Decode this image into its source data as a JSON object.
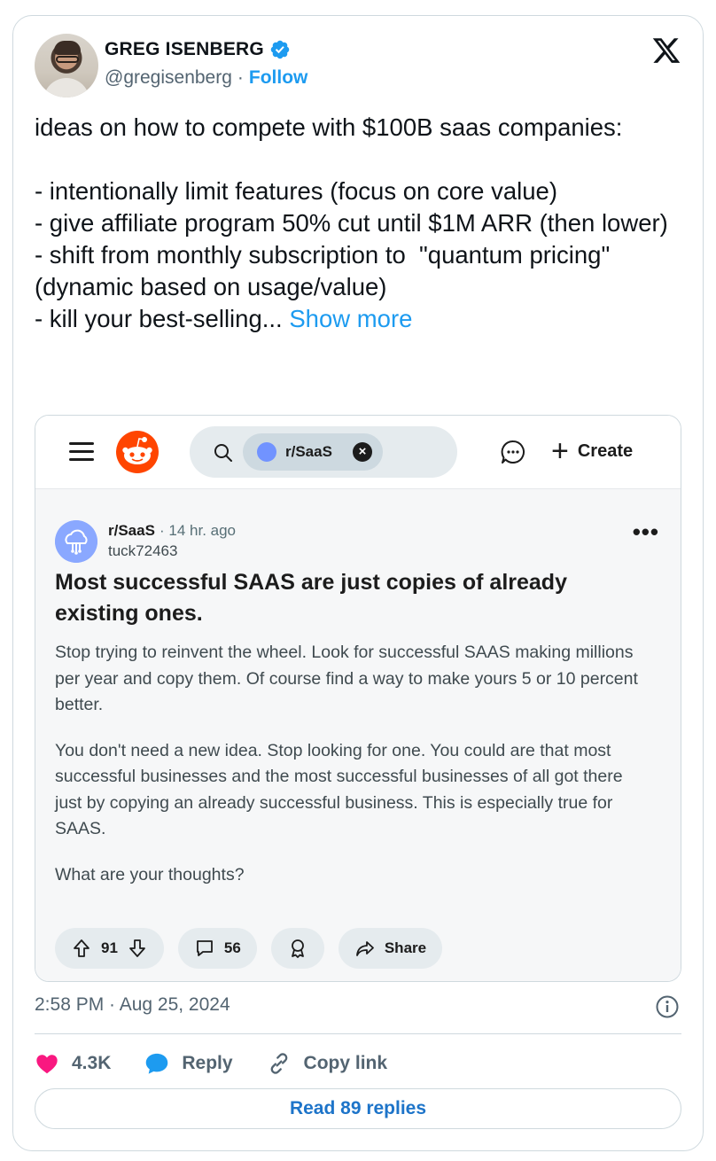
{
  "tweet": {
    "author_name": "GREG ISENBERG",
    "handle": "@gregisenberg",
    "separator": "·",
    "follow_label": "Follow",
    "text": "ideas on how to compete with $100B saas companies:\n\n- intentionally limit features (focus on core value)\n- give affiliate program 50% cut until $1M ARR (then lower)\n- shift from monthly subscription to  \"quantum pricing\" (dynamic based on usage/value)\n- kill your best-selling... ",
    "show_more_label": "Show more",
    "timestamp": "2:58 PM · Aug 25, 2024",
    "likes": "4.3K",
    "reply_label": "Reply",
    "copy_link_label": "Copy link",
    "read_replies_label": "Read 89 replies",
    "colors": {
      "accent": "#1d9bf0",
      "like": "#f91880",
      "text": "#0f1419",
      "muted": "#536471"
    },
    "icons": [
      "verified-badge-icon",
      "x-logo-icon",
      "info-icon",
      "heart-icon",
      "reply-icon",
      "link-icon"
    ]
  },
  "reddit": {
    "search_chip": "r/SaaS",
    "create_label": "Create",
    "subreddit": "r/SaaS",
    "time": "· 14 hr. ago",
    "author": "tuck72463",
    "more": "•••",
    "title": "Most successful SAAS are just copies of already existing ones.",
    "paragraphs": [
      "Stop trying to reinvent the wheel. Look for successful SAAS making millions per year and copy them. Of course find a way to make yours 5 or 10 percent better.",
      "You don't need a new idea. Stop looking for one. You could are that most successful businesses and the most successful businesses of all got there just by copying an already successful business. This is especially true for SAAS.",
      "What are your thoughts?"
    ],
    "upvotes": "91",
    "comments": "56",
    "share_label": "Share",
    "colors": {
      "orange": "#ff4500",
      "pill": "#e5ebee",
      "background": "#f6f7f8"
    }
  }
}
